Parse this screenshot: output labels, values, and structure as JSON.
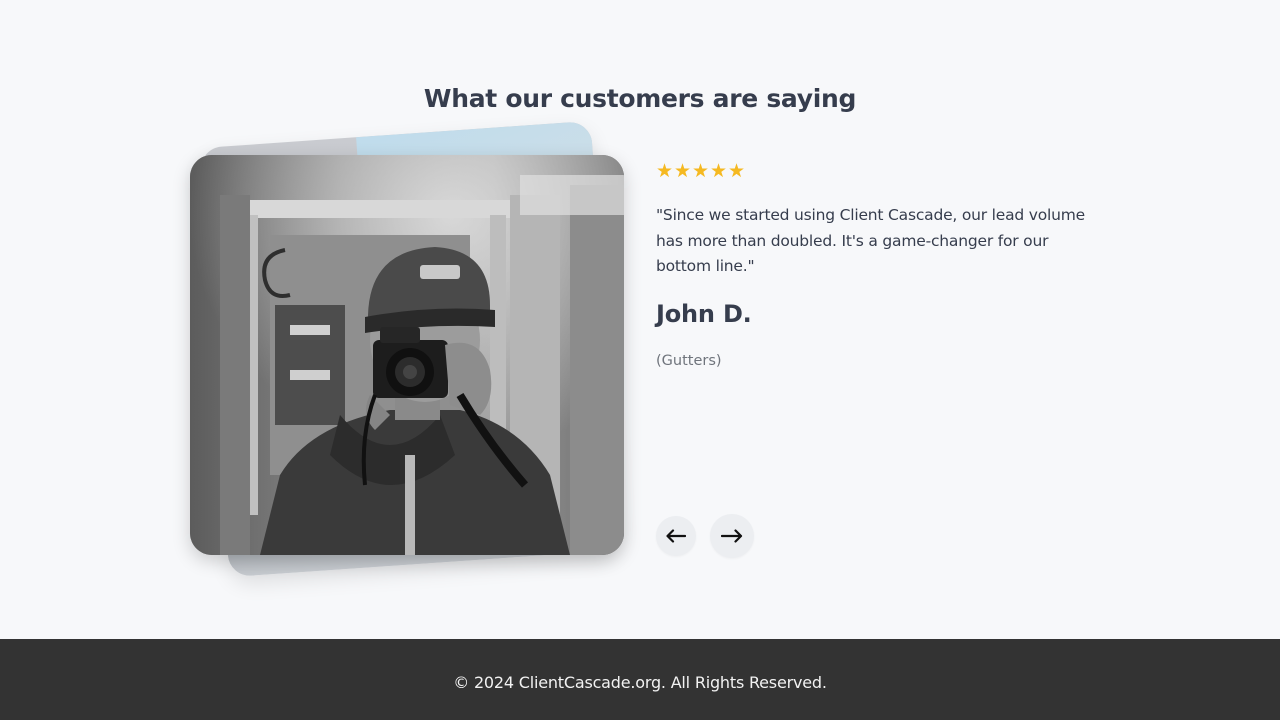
{
  "testimonials": {
    "heading": "What our customers are saying",
    "rating": 5,
    "stars": [
      "★",
      "★",
      "★",
      "★",
      "★"
    ],
    "star_color": "#f5b921",
    "quote": "\"Since we started using Client Cascade, our lead volume has more than doubled. It's a game-changer for our bottom line.\"",
    "author_name": "John D.",
    "author_trade": "(Gutters)",
    "photo_icon": "photographer-photo",
    "prev_icon": "arrow-left-icon",
    "next_icon": "arrow-right-icon"
  },
  "footer": {
    "copyright": "© 2024 ClientCascade.org. All Rights Reserved.",
    "background": "#333333"
  },
  "colors": {
    "page_background": "#f7f8fa",
    "text_dark": "#363d4d",
    "text_muted": "#6f747c"
  }
}
